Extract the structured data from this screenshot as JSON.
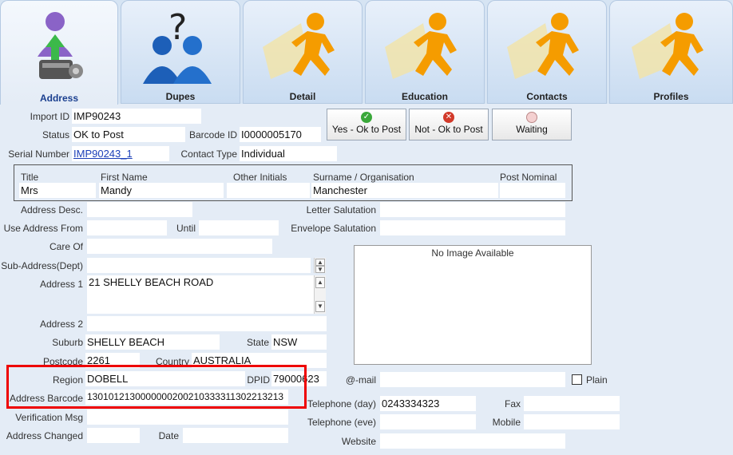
{
  "tabs": [
    {
      "label": "Address",
      "icon": "person-upload-icon"
    },
    {
      "label": "Dupes",
      "icon": "duplicate-people-icon"
    },
    {
      "label": "Detail",
      "icon": "running-man-icon"
    },
    {
      "label": "Education",
      "icon": "running-man-icon"
    },
    {
      "label": "Contacts",
      "icon": "running-man-icon"
    },
    {
      "label": "Profiles",
      "icon": "running-man-icon"
    }
  ],
  "form": {
    "import_id": {
      "label": "Import ID",
      "value": "IMP90243"
    },
    "status": {
      "label": "Status",
      "value": "OK to Post"
    },
    "barcode_id": {
      "label": "Barcode ID",
      "value": "I0000005170"
    },
    "serial_number": {
      "label": "Serial Number",
      "value": "IMP90243_1"
    },
    "contact_type": {
      "label": "Contact Type",
      "value": "Individual"
    },
    "title": {
      "label": "Title",
      "value": "Mrs"
    },
    "first_name": {
      "label": "First Name",
      "value": "Mandy"
    },
    "other_initials": {
      "label": "Other Initials",
      "value": ""
    },
    "surname": {
      "label": "Surname / Organisation",
      "value": "Manchester"
    },
    "post_nominal": {
      "label": "Post Nominal",
      "value": ""
    },
    "address_desc": {
      "label": "Address Desc.",
      "value": ""
    },
    "use_address_from": {
      "label": "Use Address From",
      "value": ""
    },
    "until": {
      "label": "Until",
      "value": ""
    },
    "care_of": {
      "label": "Care Of",
      "value": ""
    },
    "sub_address": {
      "label": "Sub-Address(Dept)",
      "value": ""
    },
    "address1": {
      "label": "Address 1",
      "value": "21 SHELLY BEACH ROAD"
    },
    "address2": {
      "label": "Address 2",
      "value": ""
    },
    "suburb": {
      "label": "Suburb",
      "value": "SHELLY BEACH"
    },
    "state": {
      "label": "State",
      "value": "NSW"
    },
    "postcode": {
      "label": "Postcode",
      "value": "2261"
    },
    "country": {
      "label": "Country",
      "value": "AUSTRALIA"
    },
    "region": {
      "label": "Region",
      "value": "DOBELL"
    },
    "dpid": {
      "label": "DPID",
      "value": "79000623"
    },
    "address_barcode": {
      "label": "Address Barcode",
      "value": "1301012130000000200210333311302213213"
    },
    "verification_msg": {
      "label": "Verification Msg",
      "value": ""
    },
    "address_changed": {
      "label": "Address Changed",
      "value": ""
    },
    "date": {
      "label": "Date",
      "value": ""
    },
    "letter_salutation": {
      "label": "Letter Salutation",
      "value": ""
    },
    "envelope_salutation": {
      "label": "Envelope Salutation",
      "value": ""
    },
    "email": {
      "label": "@-mail",
      "value": ""
    },
    "plain": {
      "label": "Plain",
      "checked": false
    },
    "telephone_day": {
      "label": "Telephone (day)",
      "value": "0243334323"
    },
    "fax": {
      "label": "Fax",
      "value": ""
    },
    "telephone_eve": {
      "label": "Telephone (eve)",
      "value": ""
    },
    "mobile": {
      "label": "Mobile",
      "value": ""
    },
    "website": {
      "label": "Website",
      "value": ""
    }
  },
  "buttons": {
    "yes": {
      "label": "Yes - Ok to Post",
      "icon": "green-check-icon",
      "color": "#3aa83a"
    },
    "no": {
      "label": "Not - Ok to Post",
      "icon": "red-x-icon",
      "color": "#d23a2a"
    },
    "waiting": {
      "label": "Waiting",
      "icon": "clock-icon",
      "color": "#e9b4b4"
    }
  },
  "image_placeholder": "No Image Available",
  "colors": {
    "highlight": "#e00000",
    "tab_active_text": "#1a3f8f",
    "background": "#e4ecf6"
  }
}
